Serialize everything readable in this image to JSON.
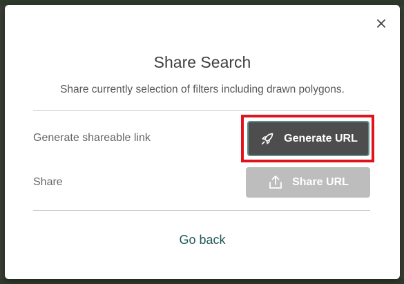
{
  "dialog": {
    "title": "Share Search",
    "description": "Share currently selection of filters including drawn polygons.",
    "close_icon": "close-icon",
    "generate_row": {
      "label": "Generate shareable link",
      "button_label": "Generate URL",
      "icon": "rocket-icon"
    },
    "share_row": {
      "label": "Share",
      "button_label": "Share URL",
      "icon": "share-upload-icon",
      "disabled": true
    },
    "back_label": "Go back"
  },
  "colors": {
    "primary_button": "#4d4d4d",
    "disabled_button": "#bdbdbd",
    "link": "#1f5a57",
    "highlight": "#e0121b"
  }
}
